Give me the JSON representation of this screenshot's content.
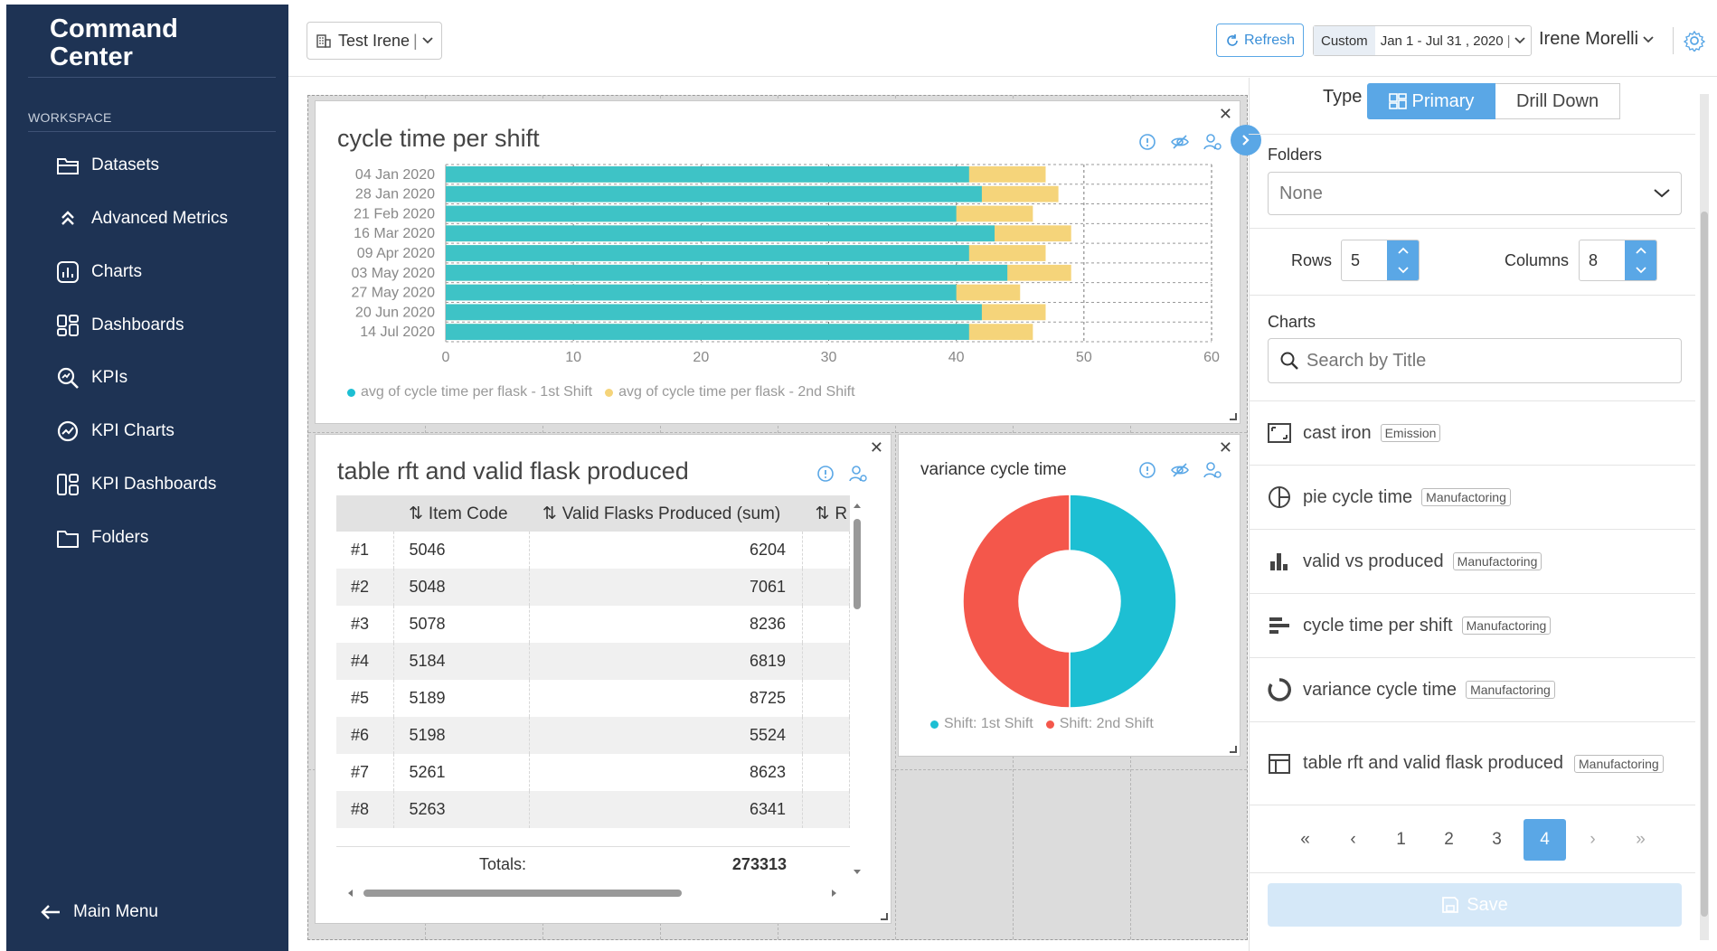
{
  "sidebar": {
    "brand_line1": "Command",
    "brand_line2": "Center",
    "section": "WORKSPACE",
    "items": [
      {
        "label": "Datasets",
        "icon": "folder-icon"
      },
      {
        "label": "Advanced Metrics",
        "icon": "chevrons-up-icon"
      },
      {
        "label": "Charts",
        "icon": "chart-icon"
      },
      {
        "label": "Dashboards",
        "icon": "dashboard-icon"
      },
      {
        "label": "KPIs",
        "icon": "magnify-chart-icon"
      },
      {
        "label": "KPI Charts",
        "icon": "gauge-icon"
      },
      {
        "label": "KPI Dashboards",
        "icon": "kpi-dashboard-icon"
      },
      {
        "label": "Folders",
        "icon": "folder-icon"
      }
    ],
    "main_menu": "Main Menu"
  },
  "header": {
    "dataset": "Test Irene",
    "refresh": "Refresh",
    "custom": "Custom",
    "date_range": "Jan 1 - Jul 31 , 2020",
    "user": "Irene Morelli"
  },
  "cards": {
    "cycle": {
      "title": "cycle time per shift",
      "legend1": "avg of cycle time per flask - 1st Shift",
      "legend2": "avg of cycle time per flask - 2nd Shift"
    },
    "table": {
      "title": "table rft and valid flask produced",
      "col_item": "Item Code",
      "col_valid": "Valid Flasks Produced (sum)",
      "col_more": "R",
      "rows": [
        {
          "idx": "#1",
          "item": "5046",
          "valid": "6204"
        },
        {
          "idx": "#2",
          "item": "5048",
          "valid": "7061"
        },
        {
          "idx": "#3",
          "item": "5078",
          "valid": "8236"
        },
        {
          "idx": "#4",
          "item": "5184",
          "valid": "6819"
        },
        {
          "idx": "#5",
          "item": "5189",
          "valid": "8725"
        },
        {
          "idx": "#6",
          "item": "5198",
          "valid": "5524"
        },
        {
          "idx": "#7",
          "item": "5261",
          "valid": "8623"
        },
        {
          "idx": "#8",
          "item": "5263",
          "valid": "6341"
        }
      ],
      "totals_label": "Totals:",
      "totals_value": "273313"
    },
    "variance": {
      "title": "variance cycle time",
      "legend1": "Shift: 1st Shift",
      "legend2": "Shift: 2nd Shift"
    }
  },
  "panel": {
    "type_label": "Type",
    "type_primary": "Primary",
    "type_drill": "Drill Down",
    "folders_label": "Folders",
    "folders_value": "None",
    "rows_label": "Rows",
    "rows_value": "5",
    "cols_label": "Columns",
    "cols_value": "8",
    "charts_label": "Charts",
    "search_placeholder": "Search by Title",
    "chart_list": [
      {
        "name": "cast iron",
        "tag": "Emission",
        "icon": "expand-box-icon"
      },
      {
        "name": "pie cycle time",
        "tag": "Manufactoring",
        "icon": "pie-icon"
      },
      {
        "name": "valid vs produced",
        "tag": "Manufactoring",
        "icon": "bar-chart-icon"
      },
      {
        "name": "cycle time per shift",
        "tag": "Manufactoring",
        "icon": "horizontal-bar-icon"
      },
      {
        "name": "variance cycle time",
        "tag": "Manufactoring",
        "icon": "donut-icon"
      },
      {
        "name": "table rft and valid flask produced",
        "tag": "Manufactoring",
        "icon": "table-icon"
      }
    ],
    "pages": [
      "1",
      "2",
      "3",
      "4"
    ],
    "active_page": "4",
    "save": "Save"
  },
  "colors": {
    "sidebar": "#1e3354",
    "accent": "#5aa7e6",
    "teal": "#1dbfd3",
    "yellow": "#f5d47a",
    "red": "#f4574b"
  },
  "chart_data": [
    {
      "type": "bar",
      "title": "cycle time per shift",
      "orientation": "horizontal",
      "categories": [
        "04 Jan 2020",
        "28 Jan 2020",
        "21 Feb 2020",
        "16 Mar 2020",
        "09 Apr 2020",
        "03 May 2020",
        "27 May 2020",
        "20 Jun 2020",
        "14 Jul 2020"
      ],
      "series": [
        {
          "name": "avg of cycle time per flask - 1st Shift",
          "values": [
            41,
            42,
            40,
            43,
            41,
            44,
            40,
            42,
            41
          ]
        },
        {
          "name": "avg of cycle time per flask - 2nd Shift",
          "values": [
            47,
            48,
            46,
            49,
            47,
            49,
            45,
            47,
            46
          ]
        }
      ],
      "xlim": [
        0,
        60
      ],
      "xticks": [
        0,
        10,
        20,
        30,
        40,
        50,
        60
      ]
    },
    {
      "type": "pie",
      "title": "variance cycle time",
      "categories": [
        "Shift: 1st Shift",
        "Shift: 2nd Shift"
      ],
      "values": [
        50,
        50
      ]
    }
  ]
}
